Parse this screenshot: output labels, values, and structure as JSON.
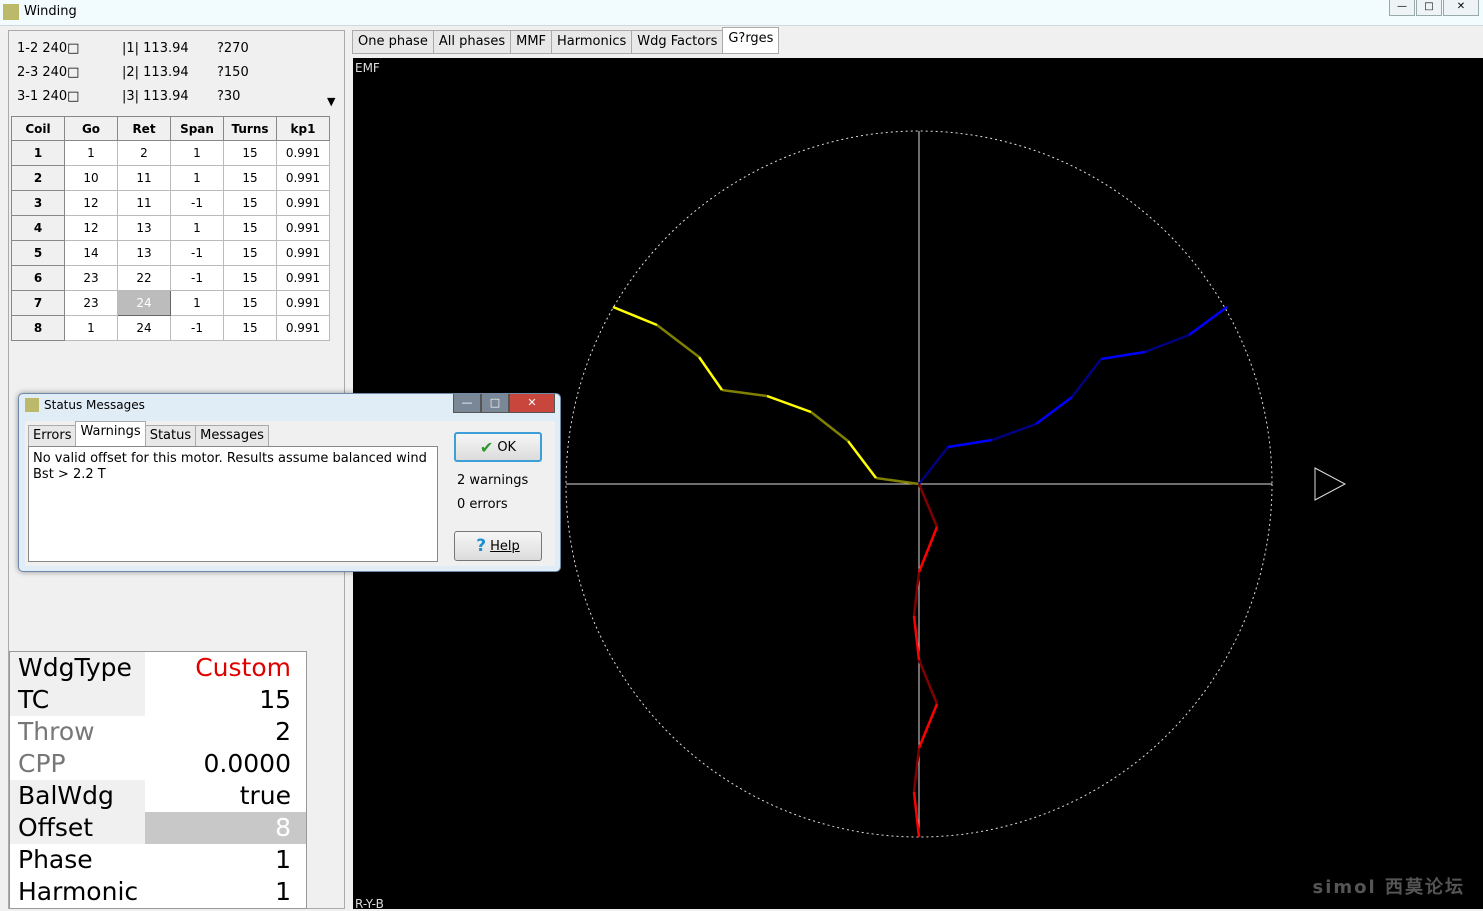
{
  "window": {
    "title": "Winding",
    "controls": [
      "—",
      "□",
      "✕"
    ]
  },
  "info_rows": [
    {
      "a": "1-2 240□",
      "b": "|1| 113.94",
      "c": "?270"
    },
    {
      "a": "2-3 240□",
      "b": "|2| 113.94",
      "c": "?150"
    },
    {
      "a": "3-1 240□",
      "b": "|3| 113.94",
      "c": "?30"
    }
  ],
  "dropdown_arrow": "▼",
  "coil_table": {
    "headers": [
      "Coil",
      "Go",
      "Ret",
      "Span",
      "Turns",
      "kp1"
    ],
    "rows": [
      [
        "1",
        "1",
        "2",
        "1",
        "15",
        "0.991"
      ],
      [
        "2",
        "10",
        "11",
        "1",
        "15",
        "0.991"
      ],
      [
        "3",
        "12",
        "11",
        "-1",
        "15",
        "0.991"
      ],
      [
        "4",
        "12",
        "13",
        "1",
        "15",
        "0.991"
      ],
      [
        "5",
        "14",
        "13",
        "-1",
        "15",
        "0.991"
      ],
      [
        "6",
        "23",
        "22",
        "-1",
        "15",
        "0.991"
      ],
      [
        "7",
        "23",
        "24",
        "1",
        "15",
        "0.991"
      ],
      [
        "8",
        "1",
        "24",
        "-1",
        "15",
        "0.991"
      ]
    ]
  },
  "properties": [
    {
      "key": "WdgType",
      "value": "Custom",
      "value_color": "#e00000"
    },
    {
      "key": "TC",
      "value": "15"
    },
    {
      "key": "Throw",
      "value": "2"
    },
    {
      "key": "CPP",
      "value": "0.0000"
    },
    {
      "key": "BalWdg",
      "value": "true"
    },
    {
      "key": "Offset",
      "value": "8"
    },
    {
      "key": "Phase",
      "value": "1"
    },
    {
      "key": "Harmonic",
      "value": "1"
    }
  ],
  "tabs": [
    "One phase",
    "All phases",
    "MMF",
    "Harmonics",
    "Wdg Factors",
    "G?rges"
  ],
  "active_tab": "G?rges",
  "plot": {
    "top_label": "EMF",
    "bottom_label": "R-Y-B",
    "phase_colors": [
      "#ffff00",
      "#0000ff",
      "#ff0000"
    ],
    "watermark": "simol 西莫论坛"
  },
  "dialog": {
    "title": "Status Messages",
    "tabs": [
      "Errors",
      "Warnings",
      "Status",
      "Messages"
    ],
    "active_tab": "Warnings",
    "messages": [
      "No valid offset for this motor. Results assume balanced wind",
      "Bst > 2.2 T"
    ],
    "ok": "OK",
    "help": "Help",
    "warnings": "2 warnings",
    "errors": "0 errors"
  }
}
